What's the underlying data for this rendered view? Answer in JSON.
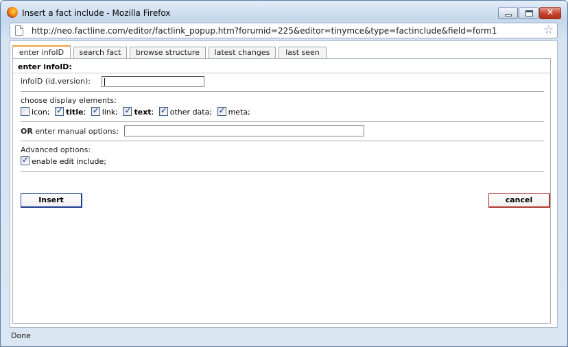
{
  "window": {
    "title": "Insert a fact include - Mozilla Firefox",
    "url": "http://neo.factline.com/editor/factlink_popup.htm?forumid=225&editor=tinymce&type=factinclude&field=form1"
  },
  "tabs": [
    {
      "label": "enter infoID",
      "active": true
    },
    {
      "label": "search fact",
      "active": false
    },
    {
      "label": "browse structure",
      "active": false
    },
    {
      "label": "latest changes",
      "active": false
    },
    {
      "label": "last seen",
      "active": false
    }
  ],
  "panel": {
    "title": "enter infoID:",
    "infoid_label": "infoID (id.version):",
    "infoid_value": "",
    "display_label": "choose display elements:",
    "display_options": [
      {
        "label": "icon",
        "checked": false,
        "bold": false
      },
      {
        "label": "title",
        "checked": true,
        "bold": true
      },
      {
        "label": "link",
        "checked": true,
        "bold": false
      },
      {
        "label": "text",
        "checked": true,
        "bold": true
      },
      {
        "label": "other data",
        "checked": true,
        "bold": false
      },
      {
        "label": "meta",
        "checked": true,
        "bold": false
      }
    ],
    "manual_prefix": "OR",
    "manual_label": "enter manual options:",
    "manual_value": "",
    "advanced_label": "Advanced options:",
    "edit_include_label": "enable edit include;",
    "edit_include_checked": true,
    "insert_label": "Insert",
    "cancel_label": "cancel"
  },
  "status": "Done",
  "icons": [
    "firefox-icon",
    "minimize-icon",
    "maximize-icon",
    "close-icon",
    "page-icon",
    "bookmark-star-icon"
  ]
}
